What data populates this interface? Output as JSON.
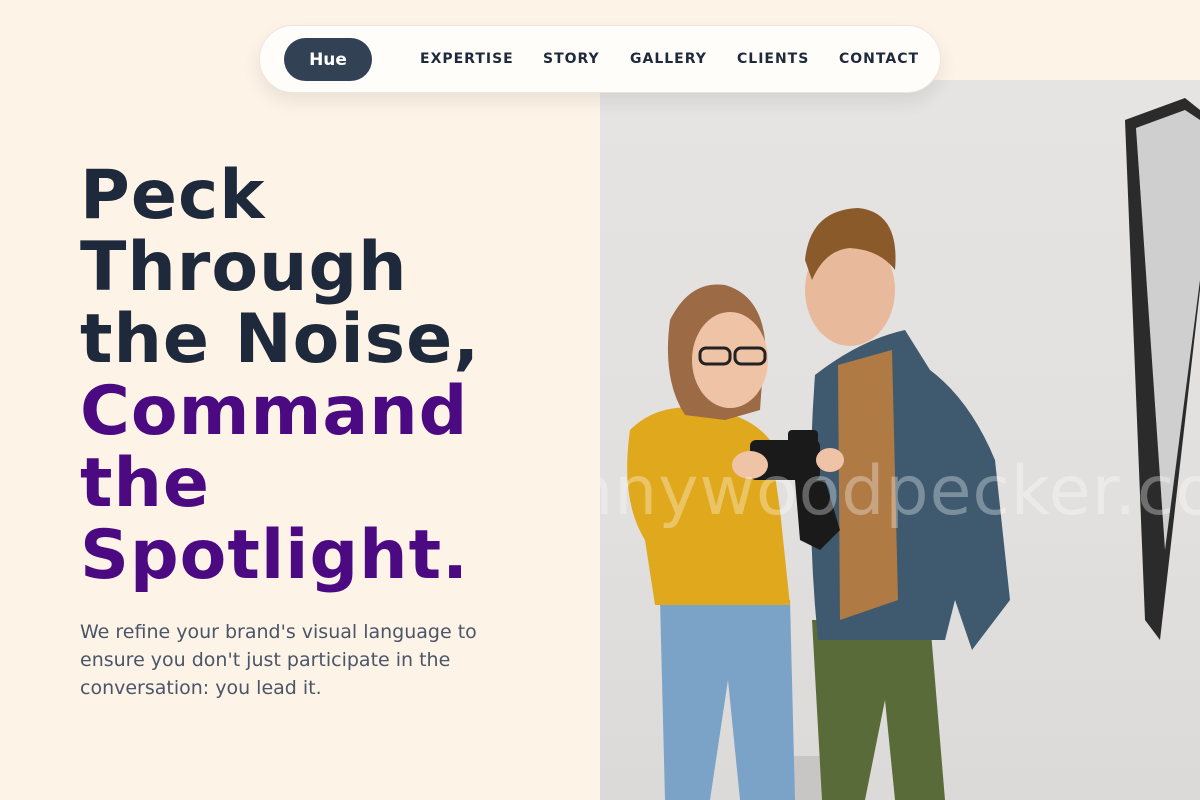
{
  "brand": {
    "logo_label": "Hue",
    "accent_color": "#4b0a82",
    "logo_bg": "#334155"
  },
  "nav": {
    "items": [
      {
        "label": "EXPERTISE"
      },
      {
        "label": "STORY"
      },
      {
        "label": "GALLERY"
      },
      {
        "label": "CLIENTS"
      },
      {
        "label": "CONTACT"
      }
    ]
  },
  "hero": {
    "headline_dark": [
      "Peck",
      "Through",
      "the Noise,"
    ],
    "headline_accent": [
      "Command",
      "the",
      "Spotlight."
    ],
    "tagline": "We refine your brand's visual language to ensure you don't just participate in the conversation: you lead it.",
    "image_watermark": "nnywoodpecker.co"
  }
}
